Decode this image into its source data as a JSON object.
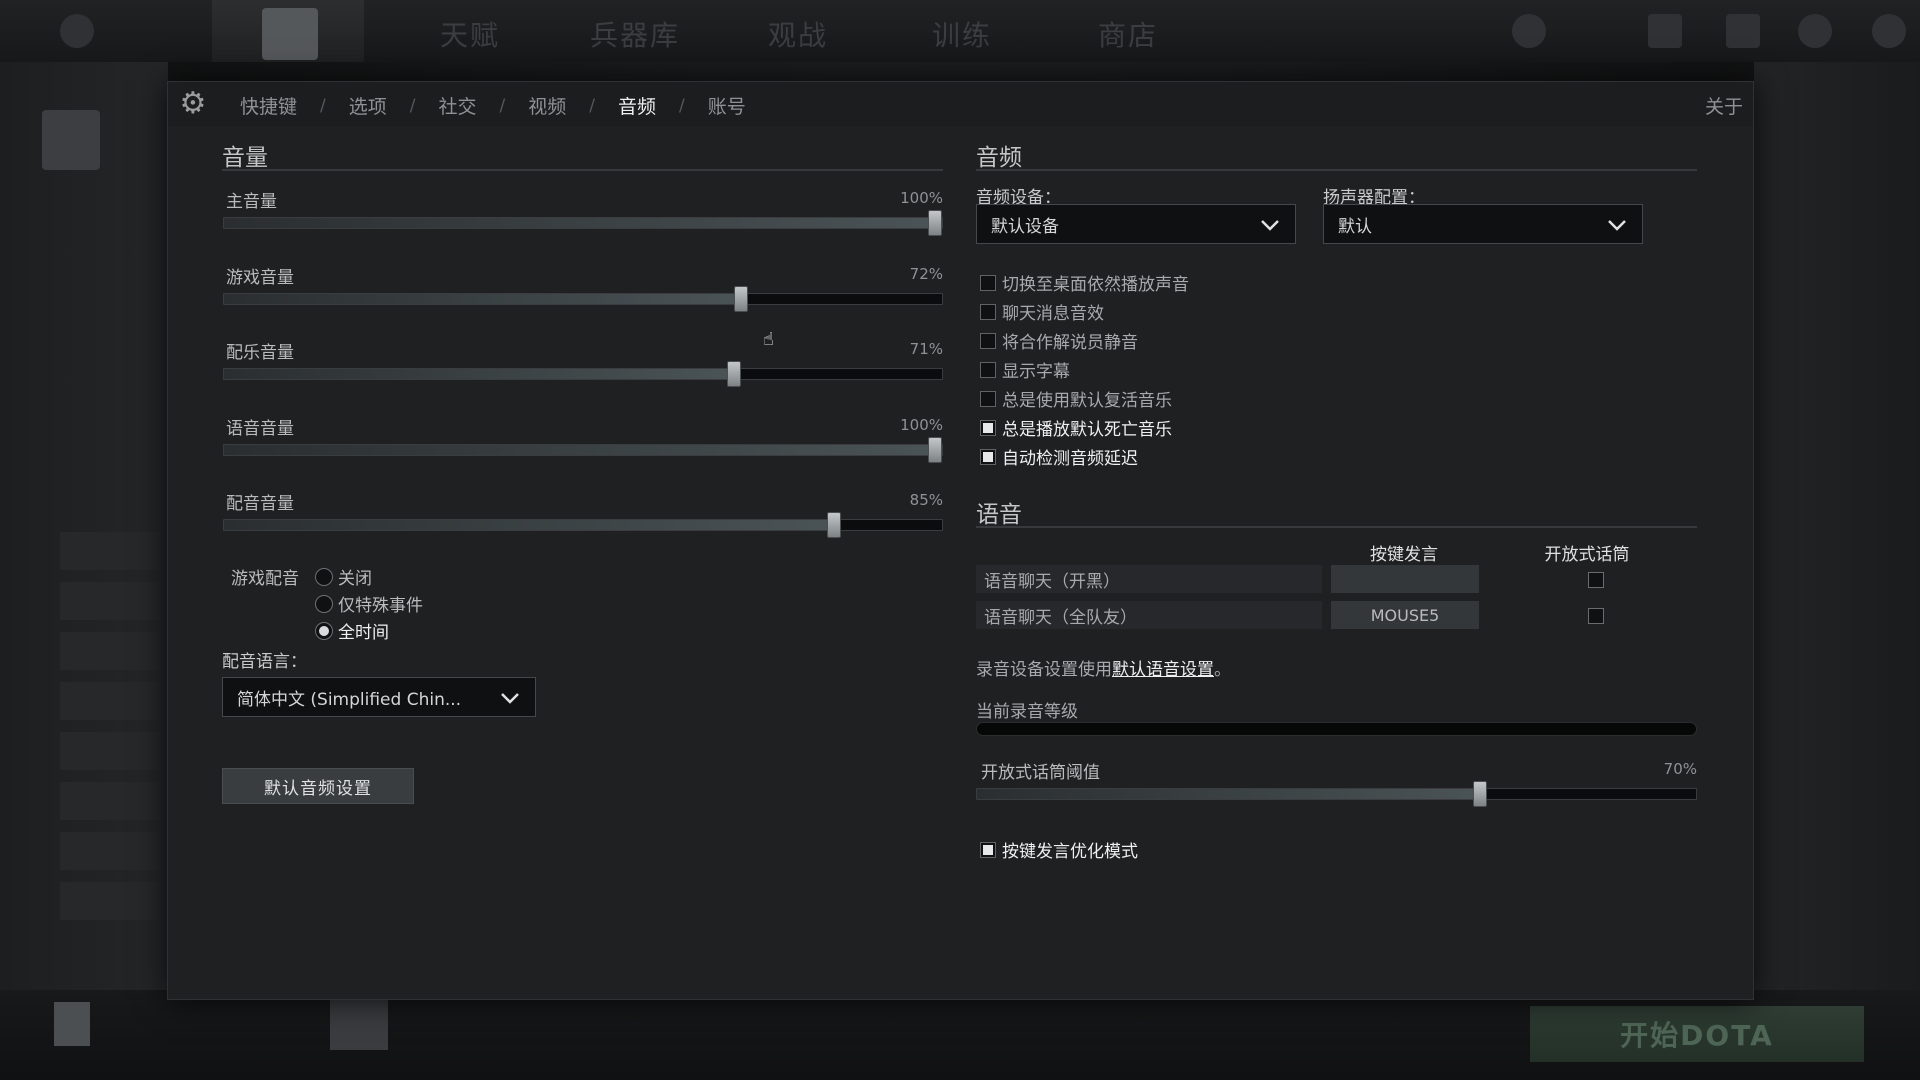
{
  "background": {
    "nav": [
      "天赋",
      "兵器库",
      "观战",
      "训练",
      "商店"
    ],
    "play_button": "开始DOTA"
  },
  "header": {
    "tabs": [
      {
        "label": "快捷键",
        "active": false
      },
      {
        "label": "选项",
        "active": false
      },
      {
        "label": "社交",
        "active": false
      },
      {
        "label": "视频",
        "active": false
      },
      {
        "label": "音频",
        "active": true
      },
      {
        "label": "账号",
        "active": false
      }
    ],
    "separator": "/",
    "about": "关于"
  },
  "volume": {
    "title": "音量",
    "sliders": [
      {
        "label": "主音量",
        "value": "100%",
        "level": 100
      },
      {
        "label": "游戏音量",
        "value": "72%",
        "level": 72
      },
      {
        "label": "配乐音量",
        "value": "71%",
        "level": 71
      },
      {
        "label": "语音音量",
        "value": "100%",
        "level": 100
      },
      {
        "label": "配音音量",
        "value": "85%",
        "level": 85
      }
    ],
    "announcer": {
      "label": "游戏配音",
      "options": [
        {
          "label": "关闭",
          "selected": false
        },
        {
          "label": "仅特殊事件",
          "selected": false
        },
        {
          "label": "全时间",
          "selected": true
        }
      ]
    },
    "language_label": "配音语言：",
    "language_value": "简体中文 (Simplified Chin...",
    "default_button": "默认音频设置"
  },
  "audio": {
    "title": "音频",
    "device_label": "音频设备：",
    "device_value": "默认设备",
    "speaker_label": "扬声器配置：",
    "speaker_value": "默认",
    "checkboxes": [
      {
        "label": "切换至桌面依然播放声音",
        "checked": false
      },
      {
        "label": "聊天消息音效",
        "checked": false
      },
      {
        "label": "将合作解说员静音",
        "checked": false
      },
      {
        "label": "显示字幕",
        "checked": false
      },
      {
        "label": "总是使用默认复活音乐",
        "checked": false
      },
      {
        "label": "总是播放默认死亡音乐",
        "checked": true
      },
      {
        "label": "自动检测音频延迟",
        "checked": true
      }
    ]
  },
  "voice": {
    "title": "语音",
    "col_ptt": "按键发言",
    "col_openmic": "开放式话筒",
    "rows": [
      {
        "label": "语音聊天（开黑）",
        "key": "",
        "open_mic": false
      },
      {
        "label": "语音聊天（全队友）",
        "key": "MOUSE5",
        "open_mic": false
      }
    ],
    "note_prefix": "录音设备设置使用",
    "note_link": "默认语音设置",
    "note_suffix": "。",
    "level_label": "当前录音等级",
    "threshold_label": "开放式话筒阈值",
    "threshold_value": "70%",
    "threshold_level": 70,
    "ptt_optimize_label": "按键发言优化模式",
    "ptt_optimize_checked": true
  },
  "colors": {
    "panel_bg": "#1e2022",
    "text_active": "#eef0f1",
    "text_muted": "#8f9295"
  }
}
